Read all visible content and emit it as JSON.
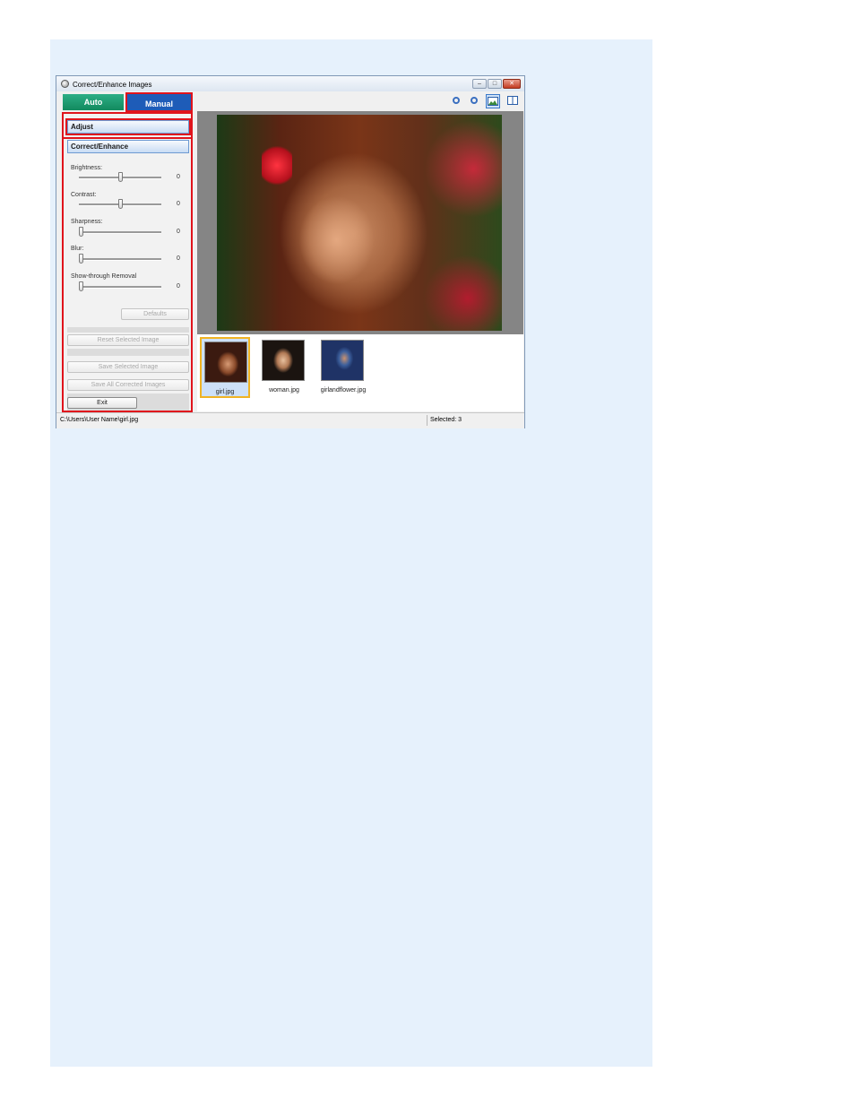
{
  "window": {
    "title": "Correct/Enhance Images",
    "buttons": {
      "minimize": "–",
      "maximize": "□",
      "close": "✕"
    }
  },
  "tabs": {
    "auto": "Auto",
    "manual": "Manual"
  },
  "manual": {
    "adjust_label": "Adjust",
    "correct_enhance_label": "Correct/Enhance",
    "sliders": [
      {
        "label": "Brightness:",
        "value": "0",
        "level": 0.5
      },
      {
        "label": "Contrast:",
        "value": "0",
        "level": 0.5
      },
      {
        "label": "Sharpness:",
        "value": "0",
        "level": 0
      },
      {
        "label": "Blur:",
        "value": "0",
        "level": 0
      },
      {
        "label": "Show-through Removal",
        "value": "0",
        "level": 0
      }
    ],
    "defaults_label": "Defaults",
    "reset_label": "Reset Selected Image",
    "save_selected_label": "Save Selected Image",
    "save_all_label": "Save All Corrected Images",
    "exit_label": "Exit"
  },
  "toolbar": {
    "icons": [
      "zoom-in-icon",
      "zoom-out-icon",
      "whole-image-view-icon",
      "compare-view-icon"
    ]
  },
  "thumbnails": [
    {
      "name": "girl.jpg",
      "selected": true
    },
    {
      "name": "woman.jpg",
      "selected": false
    },
    {
      "name": "girlandflower.jpg",
      "selected": false
    }
  ],
  "status": {
    "path": "C:\\Users\\User Name\\girl.jpg",
    "selected": "Selected: 3"
  },
  "colors": {
    "auto_tab": "#1a9c70",
    "manual_tab": "#1e5cb8",
    "highlight": "#e0141c",
    "selected_thumb": "#f0b323",
    "page_bg": "#e6f1fc"
  }
}
